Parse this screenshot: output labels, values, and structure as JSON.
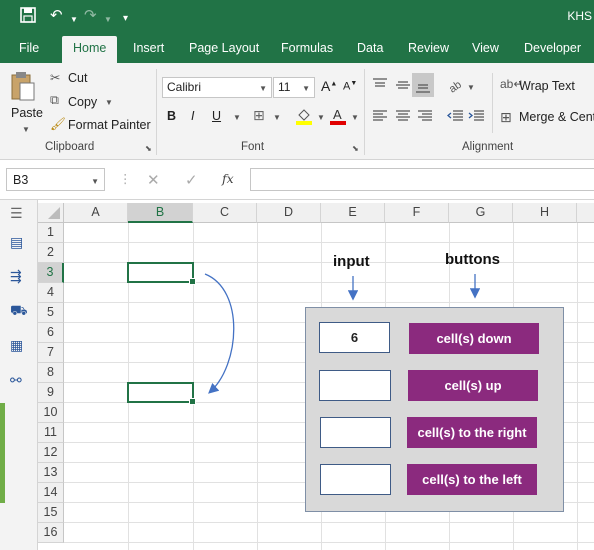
{
  "window": {
    "title": "KHS"
  },
  "tabs": [
    "File",
    "Home",
    "Insert",
    "Page Layout",
    "Formulas",
    "Data",
    "Review",
    "View",
    "Developer"
  ],
  "ribbon": {
    "clipboard": {
      "paste": "Paste",
      "cut": "Cut",
      "copy": "Copy",
      "format_painter": "Format Painter",
      "label": "Clipboard"
    },
    "font": {
      "name": "Calibri",
      "size": "11",
      "bold": "B",
      "italic": "I",
      "underline": "U",
      "label": "Font"
    },
    "alignment": {
      "wrap_text": "Wrap Text",
      "merge": "Merge & Cent",
      "label": "Alignment"
    }
  },
  "formula_bar": {
    "name_box": "B3",
    "fx": "fx",
    "value": ""
  },
  "columns": [
    "A",
    "B",
    "C",
    "D",
    "E",
    "F",
    "G",
    "H"
  ],
  "rows": [
    "1",
    "2",
    "3",
    "4",
    "5",
    "6",
    "7",
    "8",
    "9",
    "10",
    "11",
    "12",
    "13",
    "14",
    "15",
    "16"
  ],
  "sheet": {
    "input_label": "input",
    "buttons_label": "buttons",
    "inputs": [
      "6",
      "",
      "",
      ""
    ],
    "buttons": [
      "cell(s) down",
      "cell(s) up",
      "cell(s) to the right",
      "cell(s) to the left"
    ]
  },
  "colors": {
    "excel_green": "#217346",
    "button_purple": "#8b2a7e",
    "arrow_blue": "#4472c4"
  }
}
